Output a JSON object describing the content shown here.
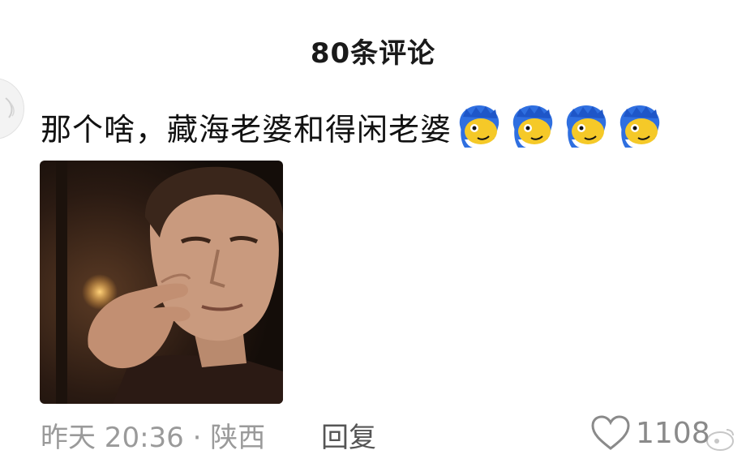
{
  "header": {
    "title": "80条评论"
  },
  "comment": {
    "text": "那个啥，藏海老婆和得闲老婆",
    "emojis": [
      "blue-hair-cartoon-emoji",
      "blue-hair-cartoon-emoji",
      "blue-hair-cartoon-emoji",
      "blue-hair-cartoon-emoji"
    ],
    "image_description_icon": "reaction-gif-image"
  },
  "footer": {
    "time_location": "昨天 20:36 · 陕西",
    "reply_label": "回复",
    "like_count": "1108"
  },
  "colors": {
    "meta_gray": "#9a9a9a",
    "emoji_blue": "#2f6fe0",
    "emoji_yellow": "#f5c928"
  }
}
